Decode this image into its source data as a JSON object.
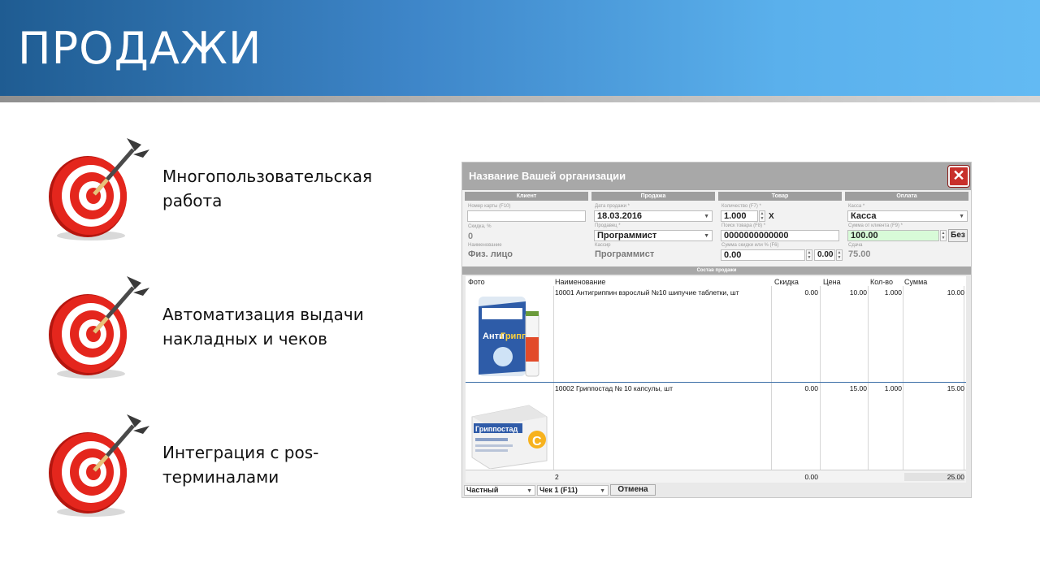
{
  "slide": {
    "title": "ПРОДАЖИ",
    "bullets": [
      {
        "line1": "Многопользовательская",
        "line2": "работа",
        "icon": "target-dart-icon"
      },
      {
        "line1": "Автоматизация выдачи",
        "line2": "накладных и чеков",
        "icon": "target-dart-icon"
      },
      {
        "line1": "Интеграция с pos-",
        "line2": "терминалами",
        "icon": "target-dart-icon"
      }
    ]
  },
  "app": {
    "title": "Название Вашей организации",
    "close_symbol": "✕",
    "sections": {
      "client": "Клиент",
      "sale": "Продажа",
      "goods": "Товар",
      "payment": "Оплата"
    },
    "client": {
      "card_label": "Номер карты (F10)",
      "card_value": "",
      "discount_label": "Скидка, %",
      "discount_value": "0",
      "name_label": "Наименование",
      "name_value": "Физ. лицо"
    },
    "sale": {
      "date_label": "Дата продажи *",
      "date_value": "18.03.2016",
      "seller_label": "Продавец *",
      "seller_value": "Программист",
      "cashier_label": "Кассир",
      "cashier_value": "Программист"
    },
    "goods": {
      "qty_label": "Количество (F7) *",
      "qty_value": "1.000",
      "x_mark": "X",
      "search_label": "Поиск товара (F8) *",
      "search_value": "0000000000000",
      "discount_label": "Сумма скидки или % (F6)",
      "discount_sum": "0.00",
      "discount_pct": "0.00"
    },
    "payment": {
      "cash_label": "Касса *",
      "cash_value": "Касса",
      "client_sum_label": "Сумма от клиента (F9) *",
      "client_sum_value": "100.00",
      "no_change_button": "Без",
      "change_label": "Сдача",
      "change_value": "75.00"
    },
    "composition_title": "Состав продажи",
    "columns": [
      "Фото",
      "Наименование",
      "Скидка",
      "Цена",
      "Кол-во",
      "Сумма"
    ],
    "rows": [
      {
        "name": "10001 Антигриппин взрослый №10 шипучие таблетки, шт",
        "discount": "0.00",
        "price": "10.00",
        "qty": "1.000",
        "sum": "10.00",
        "photo": "antigrippin-product-image"
      },
      {
        "name": "10002 Гриппостад № 10 капсулы, шт",
        "discount": "0.00",
        "price": "15.00",
        "qty": "1.000",
        "sum": "15.00",
        "photo": "grippostad-product-image"
      }
    ],
    "totals": {
      "count": "2",
      "discount": "0.00",
      "sum": "25.00"
    },
    "bottom": {
      "client_type": "Частный",
      "receipt": "Чек 1 (F11)",
      "cancel_button": "Отмена"
    },
    "product_text": {
      "p1_brand_a": "Анти",
      "p1_brand_b": "Гриппин",
      "p2_brand": "Гриппостад",
      "p2_letter": "С"
    }
  }
}
